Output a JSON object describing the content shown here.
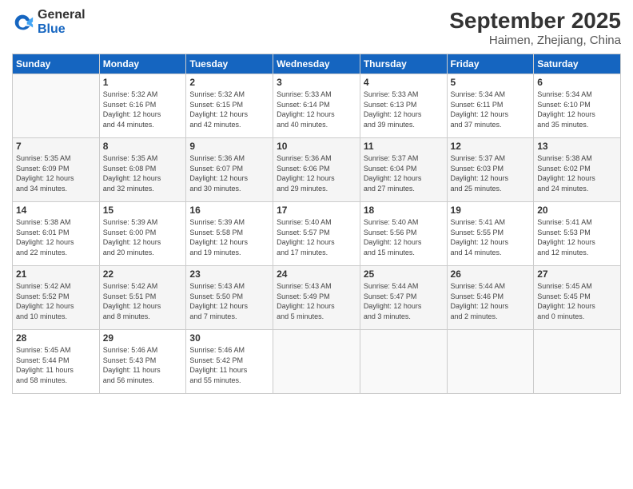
{
  "header": {
    "logo_general": "General",
    "logo_blue": "Blue",
    "title": "September 2025",
    "subtitle": "Haimen, Zhejiang, China"
  },
  "days_of_week": [
    "Sunday",
    "Monday",
    "Tuesday",
    "Wednesday",
    "Thursday",
    "Friday",
    "Saturday"
  ],
  "weeks": [
    [
      {
        "day": "",
        "info": ""
      },
      {
        "day": "1",
        "info": "Sunrise: 5:32 AM\nSunset: 6:16 PM\nDaylight: 12 hours\nand 44 minutes."
      },
      {
        "day": "2",
        "info": "Sunrise: 5:32 AM\nSunset: 6:15 PM\nDaylight: 12 hours\nand 42 minutes."
      },
      {
        "day": "3",
        "info": "Sunrise: 5:33 AM\nSunset: 6:14 PM\nDaylight: 12 hours\nand 40 minutes."
      },
      {
        "day": "4",
        "info": "Sunrise: 5:33 AM\nSunset: 6:13 PM\nDaylight: 12 hours\nand 39 minutes."
      },
      {
        "day": "5",
        "info": "Sunrise: 5:34 AM\nSunset: 6:11 PM\nDaylight: 12 hours\nand 37 minutes."
      },
      {
        "day": "6",
        "info": "Sunrise: 5:34 AM\nSunset: 6:10 PM\nDaylight: 12 hours\nand 35 minutes."
      }
    ],
    [
      {
        "day": "7",
        "info": "Sunrise: 5:35 AM\nSunset: 6:09 PM\nDaylight: 12 hours\nand 34 minutes."
      },
      {
        "day": "8",
        "info": "Sunrise: 5:35 AM\nSunset: 6:08 PM\nDaylight: 12 hours\nand 32 minutes."
      },
      {
        "day": "9",
        "info": "Sunrise: 5:36 AM\nSunset: 6:07 PM\nDaylight: 12 hours\nand 30 minutes."
      },
      {
        "day": "10",
        "info": "Sunrise: 5:36 AM\nSunset: 6:06 PM\nDaylight: 12 hours\nand 29 minutes."
      },
      {
        "day": "11",
        "info": "Sunrise: 5:37 AM\nSunset: 6:04 PM\nDaylight: 12 hours\nand 27 minutes."
      },
      {
        "day": "12",
        "info": "Sunrise: 5:37 AM\nSunset: 6:03 PM\nDaylight: 12 hours\nand 25 minutes."
      },
      {
        "day": "13",
        "info": "Sunrise: 5:38 AM\nSunset: 6:02 PM\nDaylight: 12 hours\nand 24 minutes."
      }
    ],
    [
      {
        "day": "14",
        "info": "Sunrise: 5:38 AM\nSunset: 6:01 PM\nDaylight: 12 hours\nand 22 minutes."
      },
      {
        "day": "15",
        "info": "Sunrise: 5:39 AM\nSunset: 6:00 PM\nDaylight: 12 hours\nand 20 minutes."
      },
      {
        "day": "16",
        "info": "Sunrise: 5:39 AM\nSunset: 5:58 PM\nDaylight: 12 hours\nand 19 minutes."
      },
      {
        "day": "17",
        "info": "Sunrise: 5:40 AM\nSunset: 5:57 PM\nDaylight: 12 hours\nand 17 minutes."
      },
      {
        "day": "18",
        "info": "Sunrise: 5:40 AM\nSunset: 5:56 PM\nDaylight: 12 hours\nand 15 minutes."
      },
      {
        "day": "19",
        "info": "Sunrise: 5:41 AM\nSunset: 5:55 PM\nDaylight: 12 hours\nand 14 minutes."
      },
      {
        "day": "20",
        "info": "Sunrise: 5:41 AM\nSunset: 5:53 PM\nDaylight: 12 hours\nand 12 minutes."
      }
    ],
    [
      {
        "day": "21",
        "info": "Sunrise: 5:42 AM\nSunset: 5:52 PM\nDaylight: 12 hours\nand 10 minutes."
      },
      {
        "day": "22",
        "info": "Sunrise: 5:42 AM\nSunset: 5:51 PM\nDaylight: 12 hours\nand 8 minutes."
      },
      {
        "day": "23",
        "info": "Sunrise: 5:43 AM\nSunset: 5:50 PM\nDaylight: 12 hours\nand 7 minutes."
      },
      {
        "day": "24",
        "info": "Sunrise: 5:43 AM\nSunset: 5:49 PM\nDaylight: 12 hours\nand 5 minutes."
      },
      {
        "day": "25",
        "info": "Sunrise: 5:44 AM\nSunset: 5:47 PM\nDaylight: 12 hours\nand 3 minutes."
      },
      {
        "day": "26",
        "info": "Sunrise: 5:44 AM\nSunset: 5:46 PM\nDaylight: 12 hours\nand 2 minutes."
      },
      {
        "day": "27",
        "info": "Sunrise: 5:45 AM\nSunset: 5:45 PM\nDaylight: 12 hours\nand 0 minutes."
      }
    ],
    [
      {
        "day": "28",
        "info": "Sunrise: 5:45 AM\nSunset: 5:44 PM\nDaylight: 11 hours\nand 58 minutes."
      },
      {
        "day": "29",
        "info": "Sunrise: 5:46 AM\nSunset: 5:43 PM\nDaylight: 11 hours\nand 56 minutes."
      },
      {
        "day": "30",
        "info": "Sunrise: 5:46 AM\nSunset: 5:42 PM\nDaylight: 11 hours\nand 55 minutes."
      },
      {
        "day": "",
        "info": ""
      },
      {
        "day": "",
        "info": ""
      },
      {
        "day": "",
        "info": ""
      },
      {
        "day": "",
        "info": ""
      }
    ]
  ]
}
